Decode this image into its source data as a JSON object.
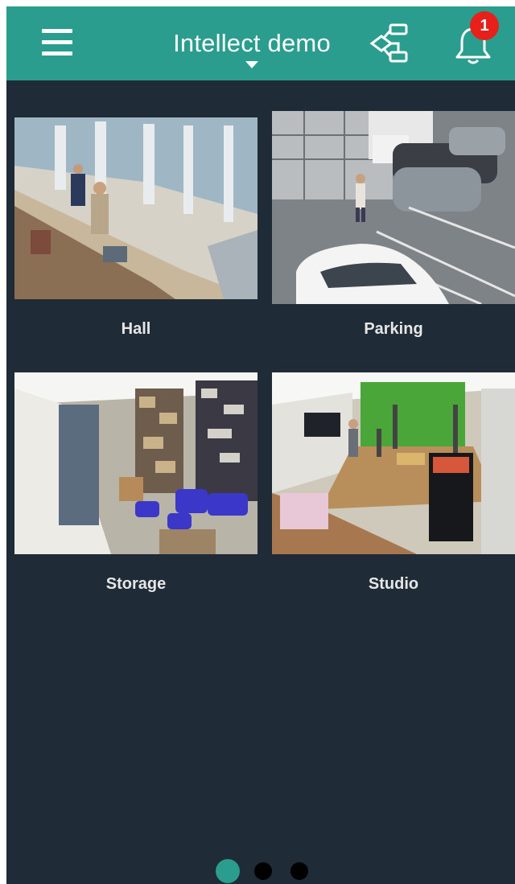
{
  "header": {
    "title": "Intellect demo",
    "notification_count": "1",
    "accent_color": "#2a9d8f",
    "badge_color": "#e8201a",
    "icons": [
      "menu-icon",
      "dropdown-caret-icon",
      "schema-icon",
      "bell-icon"
    ]
  },
  "cameras": [
    {
      "label": "Hall"
    },
    {
      "label": "Parking"
    },
    {
      "label": "Storage"
    },
    {
      "label": "Studio"
    }
  ],
  "pager": {
    "pages": 3,
    "active_index": 0,
    "active_color": "#2a9d8f"
  }
}
